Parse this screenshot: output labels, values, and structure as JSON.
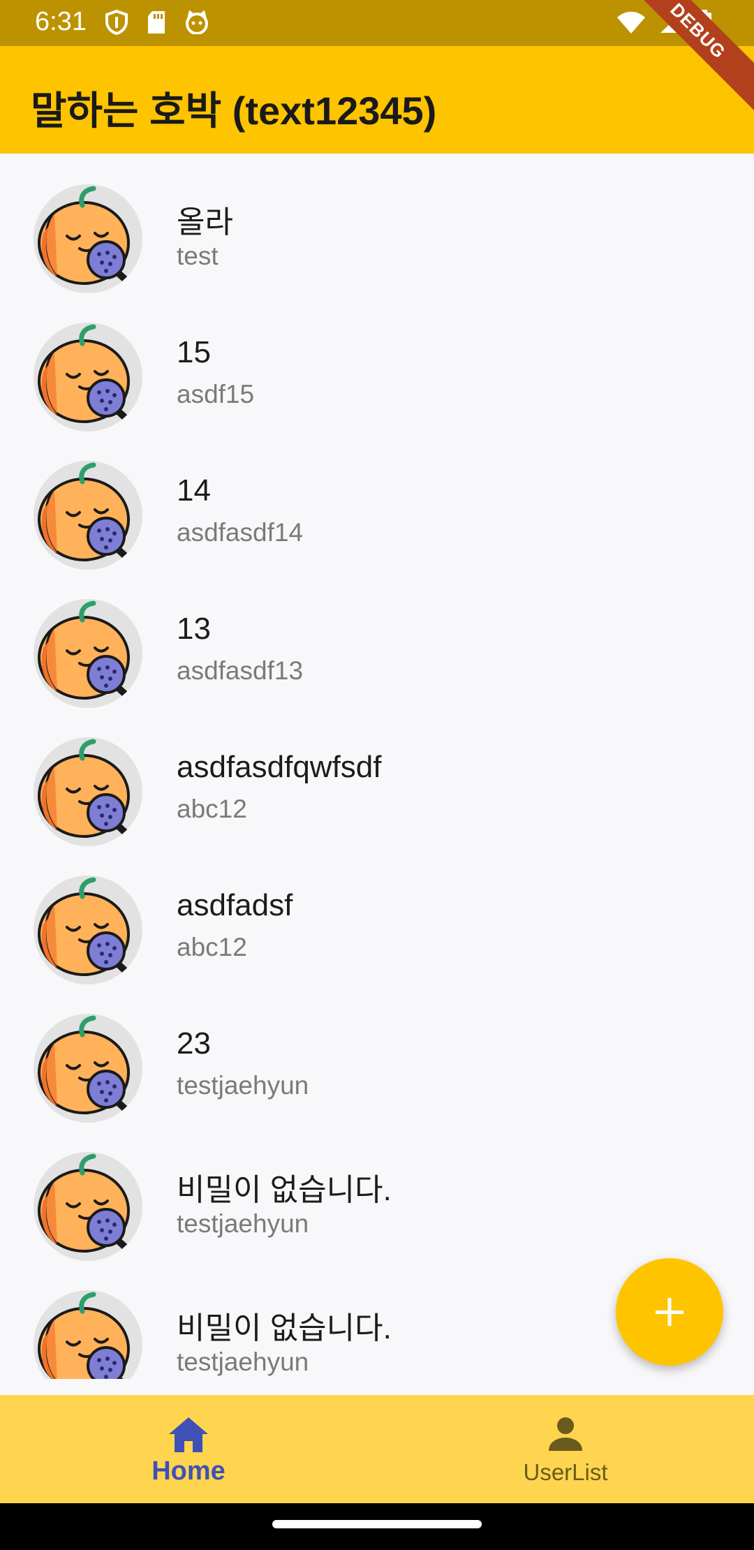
{
  "status_bar": {
    "time": "6:31",
    "left_icons": [
      "shield-icon",
      "sd-card-icon",
      "cat-face-icon"
    ],
    "right_icons": [
      "wifi-icon",
      "signal-icon",
      "battery-icon"
    ]
  },
  "app_bar": {
    "title": "말하는 호박 (text12345)",
    "debug_label": "DEBUG"
  },
  "list": {
    "items": [
      {
        "title": "올라",
        "subtitle": "test"
      },
      {
        "title": "15",
        "subtitle": "asdf15"
      },
      {
        "title": "14",
        "subtitle": "asdfasdf14"
      },
      {
        "title": "13",
        "subtitle": "asdfasdf13"
      },
      {
        "title": "asdfasdfqwfsdf",
        "subtitle": "abc12"
      },
      {
        "title": "asdfadsf",
        "subtitle": "abc12"
      },
      {
        "title": "23",
        "subtitle": "testjaehyun"
      },
      {
        "title": "비밀이 없습니다.",
        "subtitle": "testjaehyun"
      },
      {
        "title": "비밀이 없습니다.",
        "subtitle": "testjaehyun"
      }
    ]
  },
  "fab": {
    "icon": "plus-icon"
  },
  "bottom_nav": {
    "items": [
      {
        "label": "Home",
        "icon": "home-icon",
        "selected": true
      },
      {
        "label": "UserList",
        "icon": "person-icon",
        "selected": false
      }
    ]
  },
  "colors": {
    "app_bar": "#ffc400",
    "status_bar": "#bd9200",
    "bottom_nav": "#ffd54f",
    "selected_nav": "#3f51b5"
  }
}
